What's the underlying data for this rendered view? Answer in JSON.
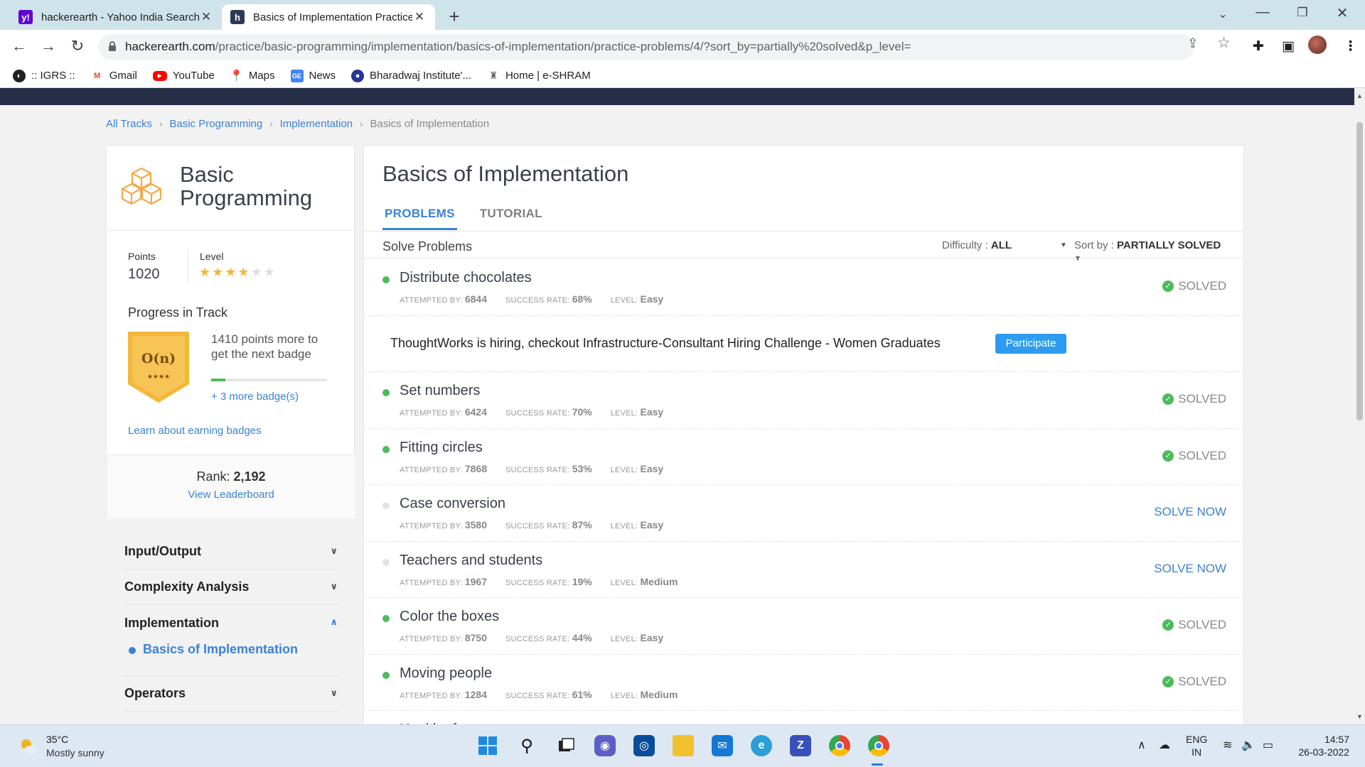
{
  "browser": {
    "tabs": [
      {
        "title": "hackerearth - Yahoo India Search",
        "favicon": "yahoo-icon"
      },
      {
        "title": "Basics of Implementation Practice",
        "favicon": "hackerearth-icon"
      }
    ],
    "url_domain": "hackerearth.com",
    "url_path": "/practice/basic-programming/implementation/basics-of-implementation/practice-problems/4/?sort_by=partially%20solved&p_level=",
    "bookmarks": [
      {
        "label": ":: IGRS ::",
        "icon": "globe-icon",
        "color": "#202124"
      },
      {
        "label": "Gmail",
        "icon": "gmail-icon",
        "color": "#ea4335"
      },
      {
        "label": "YouTube",
        "icon": "youtube-icon",
        "color": "#ff0000"
      },
      {
        "label": "Maps",
        "icon": "maps-icon",
        "color": "#34a853"
      },
      {
        "label": "News",
        "icon": "news-icon",
        "color": "#4285f4"
      },
      {
        "label": "Bharadwaj Institute'...",
        "icon": "institute-icon",
        "color": "#283593"
      },
      {
        "label": "Home | e-SHRAM",
        "icon": "emblem-icon",
        "color": "#6d6d6d"
      }
    ]
  },
  "breadcrumb": {
    "items": [
      "All Tracks",
      "Basic Programming",
      "Implementation"
    ],
    "current": "Basics of Implementation"
  },
  "track": {
    "title": "Basic Programming",
    "points_label": "Points",
    "points": "1020",
    "level_label": "Level",
    "level_stars": 4,
    "level_max": 6,
    "progress_title": "Progress in Track",
    "badge_label": "O(n)",
    "badge_stars": "★★★★",
    "badge_text": "1410 points more to get the next badge",
    "badge_progress": 0.12,
    "more_badges": "+ 3 more badge(s)",
    "learn_link": "Learn about earning badges",
    "rank_label": "Rank:",
    "rank": "2,192",
    "leaderboard_link": "View Leaderboard"
  },
  "sidemenu": {
    "items": [
      {
        "label": "Input/Output",
        "open": false
      },
      {
        "label": "Complexity Analysis",
        "open": false
      },
      {
        "label": "Implementation",
        "open": true,
        "sub": "Basics of Implementation"
      },
      {
        "label": "Operators",
        "open": false
      }
    ]
  },
  "main": {
    "title": "Basics of Implementation",
    "tabs": [
      "PROBLEMS",
      "TUTORIAL"
    ],
    "solve_title": "Solve Problems",
    "difficulty_label": "Difficulty :",
    "difficulty_value": "ALL",
    "sort_label": "Sort by :",
    "sort_value": "PARTIALLY SOLVED",
    "meta_labels": {
      "attempted": "ATTEMPTED BY:",
      "success": "SUCCESS RATE:",
      "level": "LEVEL:"
    },
    "promo": {
      "after_index": 0,
      "text": "ThoughtWorks is hiring, checkout Infrastructure-Consultant Hiring Challenge - Women Graduates",
      "button": "Participate"
    },
    "problems": [
      {
        "name": "Distribute chocolates",
        "attempted": "6844",
        "success": "68%",
        "level": "Easy",
        "status": "SOLVED",
        "solved": true
      },
      {
        "name": "Set numbers",
        "attempted": "6424",
        "success": "70%",
        "level": "Easy",
        "status": "SOLVED",
        "solved": true
      },
      {
        "name": "Fitting circles",
        "attempted": "7868",
        "success": "53%",
        "level": "Easy",
        "status": "SOLVED",
        "solved": true
      },
      {
        "name": "Case conversion",
        "attempted": "3580",
        "success": "87%",
        "level": "Easy",
        "status": "SOLVE NOW",
        "solved": false
      },
      {
        "name": "Teachers and students",
        "attempted": "1967",
        "success": "19%",
        "level": "Medium",
        "status": "SOLVE NOW",
        "solved": false
      },
      {
        "name": "Color the boxes",
        "attempted": "8750",
        "success": "44%",
        "level": "Easy",
        "status": "SOLVED",
        "solved": true
      },
      {
        "name": "Moving people",
        "attempted": "1284",
        "success": "61%",
        "level": "Medium",
        "status": "SOLVED",
        "solved": true
      },
      {
        "name": "Health of ...",
        "attempted": "",
        "success": "",
        "level": "",
        "status": "",
        "solved": false
      }
    ]
  },
  "taskbar": {
    "temp": "35°C",
    "weather": "Mostly sunny",
    "lang_line1": "ENG",
    "lang_line2": "IN",
    "time": "14:57",
    "date": "26-03-2022"
  },
  "colors": {
    "accent": "#3b82d6",
    "solved_green": "#4cbb5a",
    "star": "#f5b73b",
    "badge_gold": "#f5b73b"
  }
}
